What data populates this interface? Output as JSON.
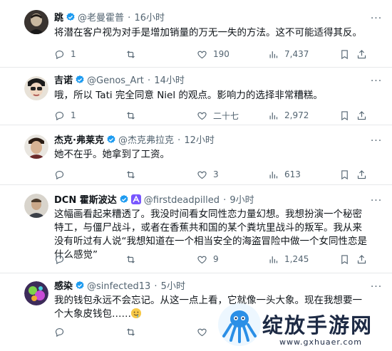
{
  "tweets": [
    {
      "name": "跳",
      "handle": "@老曼霍普",
      "time": "16小时",
      "text": "将潜在客户视为对手是增加销量的万无一失的方法。这不可能适得其反。",
      "replies": "1",
      "retweets": "",
      "likes": "190",
      "views": "7,437"
    },
    {
      "name": "吉诺",
      "handle": "@Genos_Art",
      "time": "14小时",
      "text": "哦，所以 Tati 完全同意 Niel 的观点。影响力的选择非常糟糕。",
      "replies": "1",
      "retweets": "",
      "likes": "二十七",
      "views": "2,972"
    },
    {
      "name": "杰克·弗莱克",
      "handle": "@杰克弗拉克",
      "time": "12小时",
      "text": "她不在乎。她拿到了工资。",
      "replies": "",
      "retweets": "",
      "likes": "3",
      "views": "613"
    },
    {
      "name": "DCN 霍斯波达",
      "handle": "@firstdeadpilled",
      "time": "9小时",
      "text": "这幅画看起来糟透了。我没时间看女同性恋力量幻想。我想扮演一个秘密特工，与僵尸战斗，或者在香蕉共和国的某个粪坑里战斗的叛军。我从来没有听过有人说“我想知道在一个相当安全的海盗冒险中做一个女同性恋是什么感觉”",
      "replies": "",
      "retweets": "",
      "likes": "9",
      "views": "1,245"
    },
    {
      "name": "感染",
      "handle": "@sinfected13",
      "time": "5小时",
      "text": "我的钱包永远不会忘记。从这一点上看，它就像一头大象。现在我想要一个大象皮钱包……",
      "replies": "",
      "retweets": "",
      "likes": "",
      "views": ""
    }
  ],
  "watermark": {
    "text": "绽放手游网",
    "url": "www.gxhuaer.com"
  },
  "colors": {
    "verified": "#1d9bf0",
    "muted": "#536471",
    "divider": "#e7e9ea",
    "text": "#0f1419"
  }
}
